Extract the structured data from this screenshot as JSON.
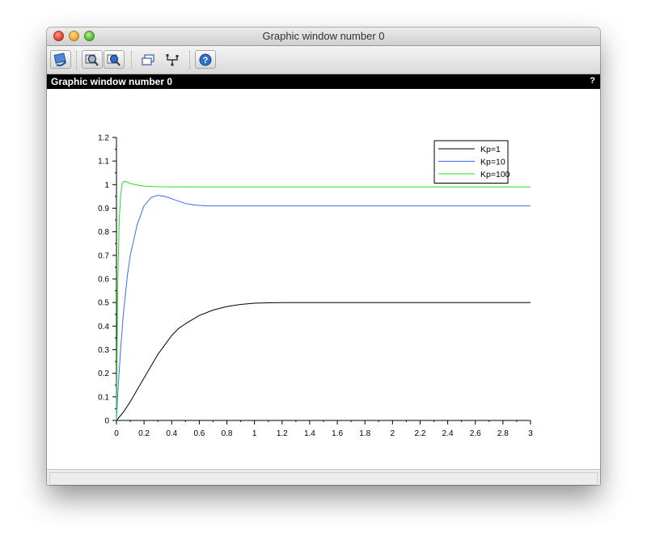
{
  "window": {
    "title": "Graphic window number 0"
  },
  "toolbar": {
    "buttons": [
      {
        "name": "rotate-button",
        "icon": "rotate-icon"
      },
      {
        "name": "zoom-button",
        "icon": "zoom-icon"
      },
      {
        "name": "unzoom-button",
        "icon": "unzoom-icon"
      },
      {
        "name": "dock-button",
        "icon": "windows-icon"
      },
      {
        "name": "datatip-button",
        "icon": "datatip-icon"
      },
      {
        "name": "help-button",
        "icon": "help-icon"
      }
    ]
  },
  "panel": {
    "title": "Graphic window number 0",
    "help": "?"
  },
  "chart_data": {
    "type": "line",
    "title": "",
    "xlabel": "",
    "ylabel": "",
    "xlim": [
      0,
      3
    ],
    "ylim": [
      0,
      1.2
    ],
    "xticks": [
      "0",
      "0.2",
      "0.4",
      "0.6",
      "0.8",
      "1",
      "1.2",
      "1.4",
      "1.6",
      "1.8",
      "2",
      "2.2",
      "2.4",
      "2.6",
      "2.8",
      "3"
    ],
    "yticks": [
      "0",
      "0.1",
      "0.2",
      "0.3",
      "0.4",
      "0.5",
      "0.6",
      "0.7",
      "0.8",
      "0.9",
      "1",
      "1.1",
      "1.2"
    ],
    "grid": false,
    "legend_position": "top-right",
    "series": [
      {
        "name": "Kp=1",
        "color": "#000000",
        "x": [
          0,
          0.05,
          0.1,
          0.15,
          0.2,
          0.25,
          0.3,
          0.35,
          0.4,
          0.45,
          0.5,
          0.6,
          0.7,
          0.8,
          0.9,
          1.0,
          1.1,
          1.2,
          1.5,
          2.0,
          2.5,
          3.0
        ],
        "y": [
          0,
          0.035,
          0.08,
          0.13,
          0.18,
          0.23,
          0.28,
          0.32,
          0.36,
          0.39,
          0.41,
          0.445,
          0.468,
          0.483,
          0.492,
          0.497,
          0.499,
          0.5,
          0.5,
          0.5,
          0.5,
          0.5
        ]
      },
      {
        "name": "Kp=10",
        "color": "#3a6cf0",
        "x": [
          0,
          0.01,
          0.03,
          0.05,
          0.08,
          0.1,
          0.15,
          0.2,
          0.25,
          0.3,
          0.35,
          0.4,
          0.45,
          0.5,
          0.55,
          0.6,
          0.65,
          0.8,
          1.0,
          1.5,
          2.0,
          2.5,
          3.0
        ],
        "y": [
          0,
          0.12,
          0.3,
          0.45,
          0.62,
          0.7,
          0.83,
          0.91,
          0.945,
          0.955,
          0.95,
          0.94,
          0.93,
          0.92,
          0.915,
          0.912,
          0.91,
          0.91,
          0.91,
          0.91,
          0.91,
          0.91,
          0.91
        ]
      },
      {
        "name": "Kp=100",
        "color": "#22e022",
        "x": [
          0,
          0.005,
          0.01,
          0.02,
          0.03,
          0.04,
          0.05,
          0.06,
          0.08,
          0.1,
          0.15,
          0.2,
          0.3,
          0.5,
          1.0,
          2.0,
          3.0
        ],
        "y": [
          0,
          0.35,
          0.6,
          0.85,
          0.95,
          1.0,
          1.012,
          1.014,
          1.01,
          1.005,
          0.998,
          0.994,
          0.991,
          0.99,
          0.99,
          0.99,
          0.99
        ]
      }
    ]
  }
}
